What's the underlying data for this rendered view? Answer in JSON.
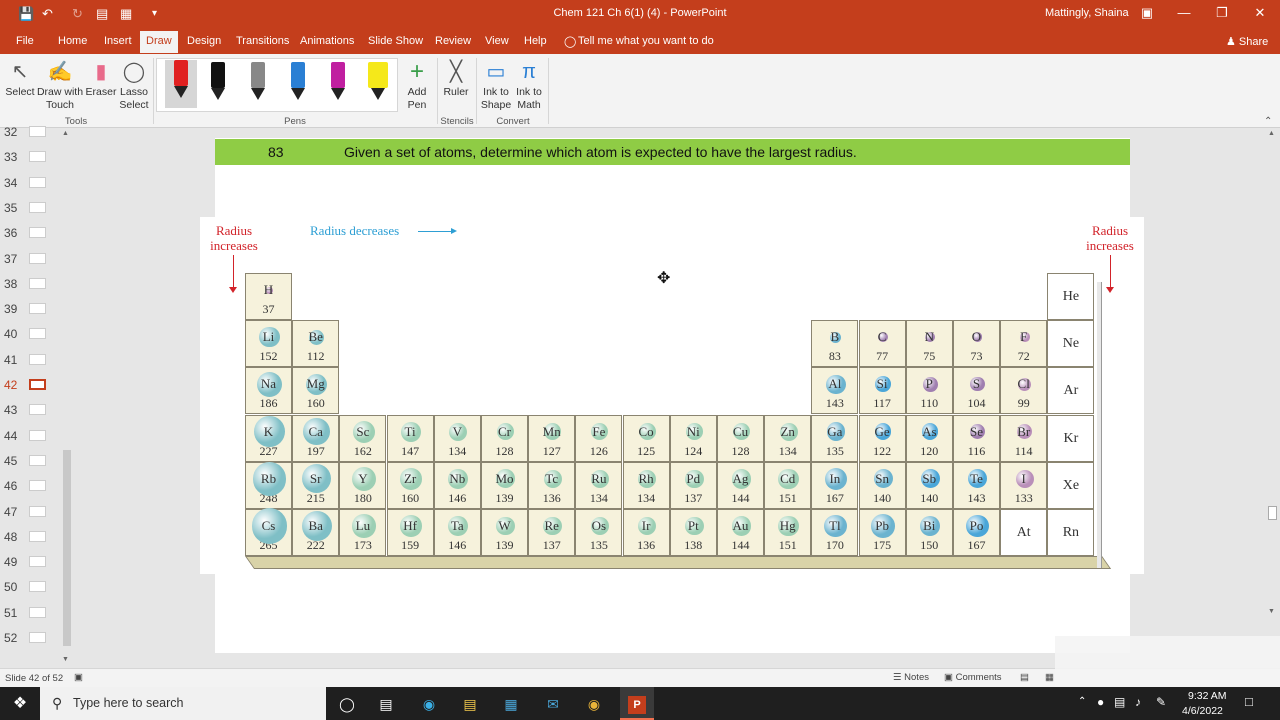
{
  "window": {
    "title": "Chem 121 Ch 6(1) (4)  -  PowerPoint",
    "user": "Mattingly, Shaina"
  },
  "tabs": [
    {
      "label": "File"
    },
    {
      "label": "Home"
    },
    {
      "label": "Insert"
    },
    {
      "label": "Draw"
    },
    {
      "label": "Design"
    },
    {
      "label": "Transitions"
    },
    {
      "label": "Animations"
    },
    {
      "label": "Slide Show"
    },
    {
      "label": "Review"
    },
    {
      "label": "View"
    },
    {
      "label": "Help"
    }
  ],
  "tell_me": "Tell me what you want to do",
  "share": "Share",
  "ribbon": {
    "select": "Select",
    "draw_with_touch": [
      "Draw with",
      "Touch"
    ],
    "eraser": "Eraser",
    "lasso": [
      "Lasso",
      "Select"
    ],
    "tools_group": "Tools",
    "pens_group": "Pens",
    "add_pen": [
      "Add",
      "Pen"
    ],
    "ruler": "Ruler",
    "stencils_group": "Stencils",
    "ink_to_shape": [
      "Ink to",
      "Shape"
    ],
    "ink_to_math": [
      "Ink to",
      "Math"
    ],
    "convert_group": "Convert"
  },
  "pens": [
    {
      "color": "#e02020"
    },
    {
      "color": "#111111"
    },
    {
      "color": "#888888"
    },
    {
      "color": "#2a7fd4"
    },
    {
      "color": "#c01fa0"
    },
    {
      "color": "#f5e81a"
    }
  ],
  "slide_numbers": [
    "32",
    "33",
    "34",
    "35",
    "36",
    "37",
    "38",
    "39",
    "40",
    "41",
    "42",
    "43",
    "44",
    "45",
    "46",
    "47",
    "48",
    "49",
    "50",
    "51",
    "52"
  ],
  "selected_slide": "42",
  "slide": {
    "number": "83",
    "text": "Given a set of atoms, determine which atom is expected to have the largest radius.",
    "radius_increases_left": [
      "Radius",
      "increases"
    ],
    "radius_increases_right": [
      "Radius",
      "increases"
    ],
    "radius_decreases": "Radius decreases"
  },
  "elements": {
    "row1": [
      {
        "s": "H",
        "r": "37",
        "c": "#b98fb9"
      }
    ],
    "row2": [
      {
        "s": "Li",
        "r": "152",
        "c": "#7fbfc6"
      },
      {
        "s": "Be",
        "r": "112",
        "c": "#7fbfc6"
      },
      {
        "s": "B",
        "r": "83",
        "c": "#6bb3cf"
      },
      {
        "s": "C",
        "r": "77",
        "c": "#a07fb0"
      },
      {
        "s": "N",
        "r": "75",
        "c": "#a07fb0"
      },
      {
        "s": "O",
        "r": "73",
        "c": "#a07fb0"
      },
      {
        "s": "F",
        "r": "72",
        "c": "#b98fb9"
      }
    ],
    "row3": [
      {
        "s": "Na",
        "r": "186",
        "c": "#7fbfc6"
      },
      {
        "s": "Mg",
        "r": "160",
        "c": "#7fbfc6"
      },
      {
        "s": "Al",
        "r": "143",
        "c": "#6bb3cf"
      },
      {
        "s": "Si",
        "r": "117",
        "c": "#4aa6d8"
      },
      {
        "s": "P",
        "r": "110",
        "c": "#a07fb0"
      },
      {
        "s": "S",
        "r": "104",
        "c": "#a07fb0"
      },
      {
        "s": "Cl",
        "r": "99",
        "c": "#b98fb9"
      }
    ],
    "row4": [
      {
        "s": "K",
        "r": "227",
        "c": "#7fbfc6"
      },
      {
        "s": "Ca",
        "r": "197",
        "c": "#7fbfc6"
      },
      {
        "s": "Sc",
        "r": "162",
        "c": "#9ccfb4"
      },
      {
        "s": "Ti",
        "r": "147",
        "c": "#9ccfb4"
      },
      {
        "s": "V",
        "r": "134",
        "c": "#9ccfb4"
      },
      {
        "s": "Cr",
        "r": "128",
        "c": "#9ccfb4"
      },
      {
        "s": "Mn",
        "r": "127",
        "c": "#9ccfb4"
      },
      {
        "s": "Fe",
        "r": "126",
        "c": "#9ccfb4"
      },
      {
        "s": "Co",
        "r": "125",
        "c": "#9ccfb4"
      },
      {
        "s": "Ni",
        "r": "124",
        "c": "#9ccfb4"
      },
      {
        "s": "Cu",
        "r": "128",
        "c": "#9ccfb4"
      },
      {
        "s": "Zn",
        "r": "134",
        "c": "#9ccfb4"
      },
      {
        "s": "Ga",
        "r": "135",
        "c": "#6bb3cf"
      },
      {
        "s": "Ge",
        "r": "122",
        "c": "#4aa6d8"
      },
      {
        "s": "As",
        "r": "120",
        "c": "#4aa6d8"
      },
      {
        "s": "Se",
        "r": "116",
        "c": "#a07fb0"
      },
      {
        "s": "Br",
        "r": "114",
        "c": "#b98fb9"
      }
    ],
    "row5": [
      {
        "s": "Rb",
        "r": "248",
        "c": "#7fbfc6"
      },
      {
        "s": "Sr",
        "r": "215",
        "c": "#7fbfc6"
      },
      {
        "s": "Y",
        "r": "180",
        "c": "#9ccfb4"
      },
      {
        "s": "Zr",
        "r": "160",
        "c": "#9ccfb4"
      },
      {
        "s": "Nb",
        "r": "146",
        "c": "#9ccfb4"
      },
      {
        "s": "Mo",
        "r": "139",
        "c": "#9ccfb4"
      },
      {
        "s": "Tc",
        "r": "136",
        "c": "#9ccfb4"
      },
      {
        "s": "Ru",
        "r": "134",
        "c": "#9ccfb4"
      },
      {
        "s": "Rh",
        "r": "134",
        "c": "#9ccfb4"
      },
      {
        "s": "Pd",
        "r": "137",
        "c": "#9ccfb4"
      },
      {
        "s": "Ag",
        "r": "144",
        "c": "#9ccfb4"
      },
      {
        "s": "Cd",
        "r": "151",
        "c": "#9ccfb4"
      },
      {
        "s": "In",
        "r": "167",
        "c": "#6bb3cf"
      },
      {
        "s": "Sn",
        "r": "140",
        "c": "#6bb3cf"
      },
      {
        "s": "Sb",
        "r": "140",
        "c": "#4aa6d8"
      },
      {
        "s": "Te",
        "r": "143",
        "c": "#4aa6d8"
      },
      {
        "s": "I",
        "r": "133",
        "c": "#b98fb9"
      }
    ],
    "row6": [
      {
        "s": "Cs",
        "r": "265",
        "c": "#7fbfc6"
      },
      {
        "s": "Ba",
        "r": "222",
        "c": "#7fbfc6"
      },
      {
        "s": "Lu",
        "r": "173",
        "c": "#9ccfb4"
      },
      {
        "s": "Hf",
        "r": "159",
        "c": "#9ccfb4"
      },
      {
        "s": "Ta",
        "r": "146",
        "c": "#9ccfb4"
      },
      {
        "s": "W",
        "r": "139",
        "c": "#9ccfb4"
      },
      {
        "s": "Re",
        "r": "137",
        "c": "#9ccfb4"
      },
      {
        "s": "Os",
        "r": "135",
        "c": "#9ccfb4"
      },
      {
        "s": "Ir",
        "r": "136",
        "c": "#9ccfb4"
      },
      {
        "s": "Pt",
        "r": "138",
        "c": "#9ccfb4"
      },
      {
        "s": "Au",
        "r": "144",
        "c": "#9ccfb4"
      },
      {
        "s": "Hg",
        "r": "151",
        "c": "#9ccfb4"
      },
      {
        "s": "Tl",
        "r": "170",
        "c": "#6bb3cf"
      },
      {
        "s": "Pb",
        "r": "175",
        "c": "#6bb3cf"
      },
      {
        "s": "Bi",
        "r": "150",
        "c": "#6bb3cf"
      },
      {
        "s": "Po",
        "r": "167",
        "c": "#4aa6d8"
      },
      {
        "s": "At",
        "r": "",
        "c": ""
      }
    ],
    "noble": [
      "He",
      "Ne",
      "Ar",
      "Kr",
      "Xe",
      "Rn"
    ]
  },
  "status": {
    "slide_of": "Slide 42 of 52",
    "notes": "Notes",
    "comments": "Comments"
  },
  "taskbar": {
    "search_placeholder": "Type here to search",
    "time": "9:32 AM",
    "date": "4/6/2022"
  }
}
